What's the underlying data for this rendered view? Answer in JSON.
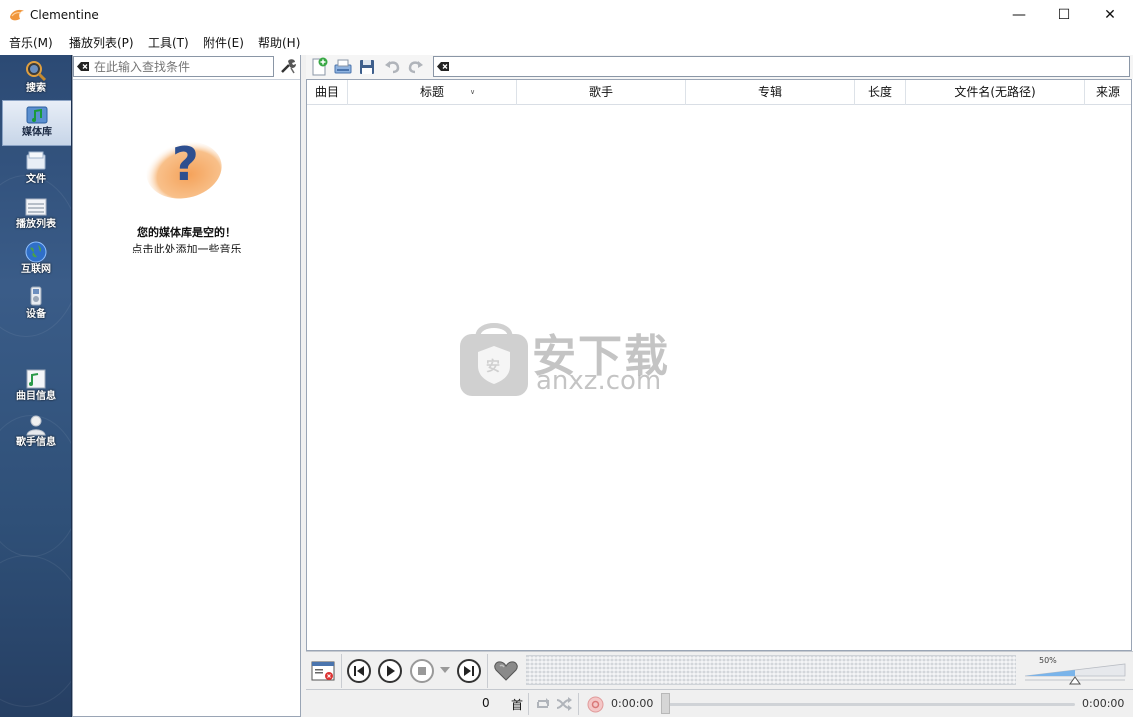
{
  "window": {
    "title": "Clementine",
    "minimize": "—",
    "maximize": "☐",
    "close": "✕"
  },
  "menu": [
    "音乐(M)",
    "播放列表(P)",
    "工具(T)",
    "附件(E)",
    "帮助(H)"
  ],
  "sidebar": {
    "items": [
      {
        "label": "搜索",
        "icon": "search-icon",
        "active": false
      },
      {
        "label": "媒体库",
        "icon": "library-icon",
        "active": true
      },
      {
        "label": "文件",
        "icon": "files-icon",
        "active": false
      },
      {
        "label": "播放列表",
        "icon": "playlists-icon",
        "active": false
      },
      {
        "label": "互联网",
        "icon": "internet-icon",
        "active": false
      },
      {
        "label": "设备",
        "icon": "devices-icon",
        "active": false
      },
      {
        "label": "曲目信息",
        "icon": "song-info-icon",
        "active": false
      },
      {
        "label": "歌手信息",
        "icon": "artist-info-icon",
        "active": false
      }
    ]
  },
  "library": {
    "filter_placeholder": "在此输入查找条件",
    "empty_title": "您的媒体库是空的！",
    "empty_hint": "点击此处添加一些音乐"
  },
  "playlist": {
    "columns": [
      "曲目",
      "标题",
      "歌手",
      "专辑",
      "长度",
      "文件名(无路径)",
      "来源"
    ],
    "toolbar": [
      "new-playlist-icon",
      "load-playlist-icon",
      "save-playlist-icon",
      "undo-icon",
      "redo-icon"
    ]
  },
  "watermark": {
    "cn": "安下载",
    "en": "anxz.com"
  },
  "player": {
    "volume": "50%",
    "volume_level": 0.5,
    "track_count": "0",
    "track_unit": "首",
    "elapsed": "0:00:00",
    "total": "0:00:00"
  },
  "colors": {
    "sidebar": "#2f5078",
    "accent_orange": "#f08a3a",
    "question_blue": "#2e4f8f"
  }
}
